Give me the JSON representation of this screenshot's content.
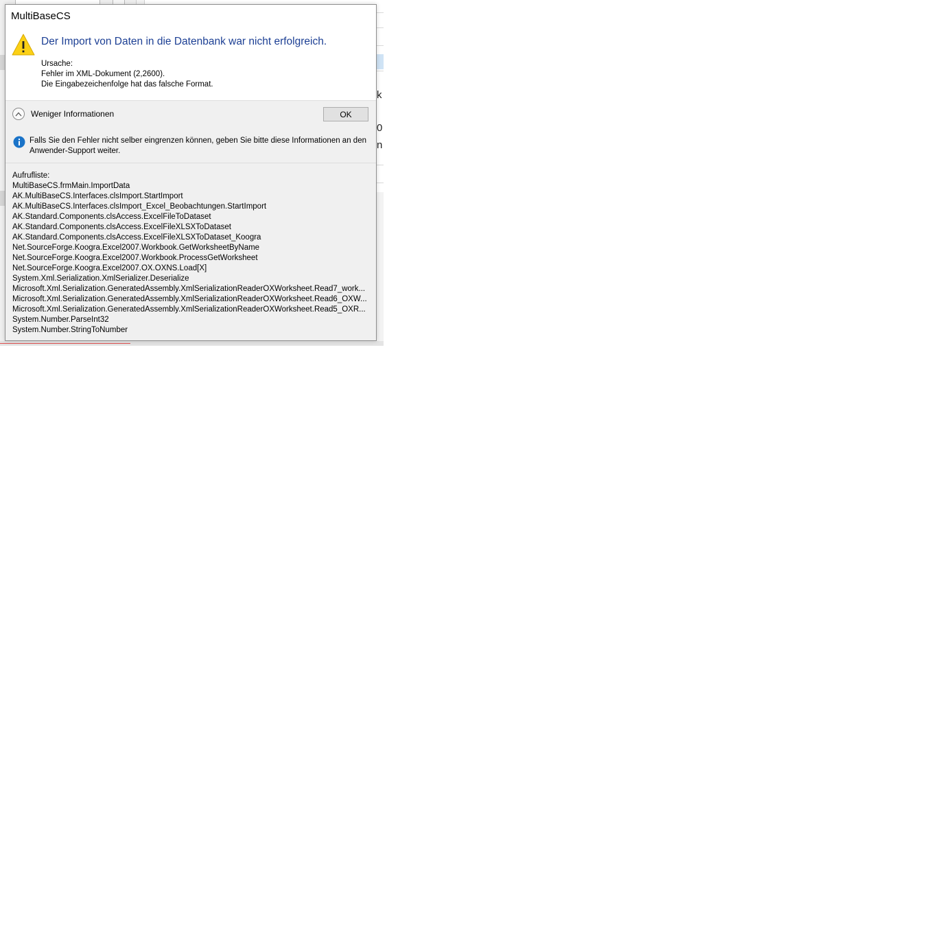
{
  "dialog": {
    "title": "MultiBaseCS",
    "headline": "Der Import von Daten in die Datenbank war nicht erfolgreich.",
    "reason_lines": [
      "Ursache:",
      "Fehler im XML-Dokument (2,2600).",
      "Die Eingabezeichenfolge hat das falsche Format."
    ],
    "toggle_label": "Weniger Informationen",
    "ok_label": "OK",
    "info_text": "Falls Sie den Fehler nicht selber eingrenzen können, geben Sie bitte diese Informationen an den Anwender-Support weiter.",
    "stack_lines": [
      "Aufrufliste:",
      "MultiBaseCS.frmMain.ImportData",
      "AK.MultiBaseCS.Interfaces.clsImport.StartImport",
      "AK.MultiBaseCS.Interfaces.clsImport_Excel_Beobachtungen.StartImport",
      "AK.Standard.Components.clsAccess.ExcelFileToDataset",
      "AK.Standard.Components.clsAccess.ExcelFileXLSXToDataset",
      "AK.Standard.Components.clsAccess.ExcelFileXLSXToDataset_Koogra",
      "Net.SourceForge.Koogra.Excel2007.Workbook.GetWorksheetByName",
      "Net.SourceForge.Koogra.Excel2007.Workbook.ProcessGetWorksheet",
      "Net.SourceForge.Koogra.Excel2007.OX.OXNS.Load[X]",
      "System.Xml.Serialization.XmlSerializer.Deserialize",
      "Microsoft.Xml.Serialization.GeneratedAssembly.XmlSerializationReaderOXWorksheet.Read7_work...",
      "Microsoft.Xml.Serialization.GeneratedAssembly.XmlSerializationReaderOXWorksheet.Read6_OXW...",
      "Microsoft.Xml.Serialization.GeneratedAssembly.XmlSerializationReaderOXWorksheet.Read5_OXR...",
      "System.Number.ParseInt32",
      "System.Number.StringToNumber"
    ],
    "icons": {
      "warning": "warning-icon",
      "toggle": "chevron-up-icon",
      "info": "info-icon"
    },
    "colors": {
      "headline": "#1c3f94",
      "warning_fill": "#fcd116",
      "info_fill": "#1a73c8"
    }
  },
  "background": {
    "glyphs": [
      "k",
      "0",
      "n"
    ]
  }
}
